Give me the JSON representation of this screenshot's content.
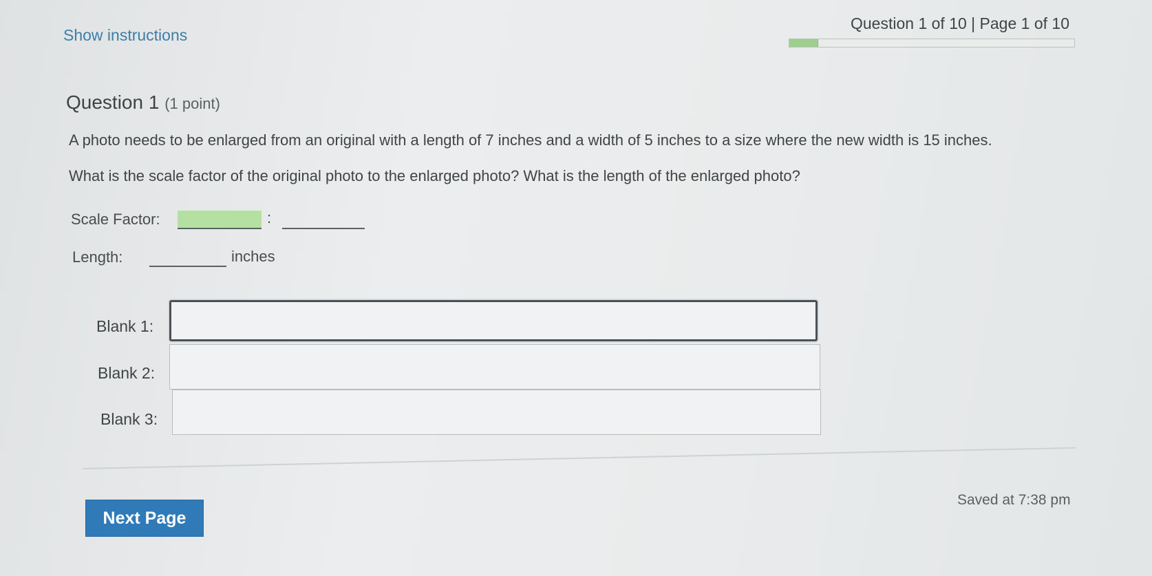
{
  "header": {
    "show_instructions": "Show instructions",
    "progress_label": "Question 1 of 10 | Page 1 of 10",
    "progress_fraction": 0.1
  },
  "question": {
    "title": "Question 1",
    "points": "(1 point)",
    "text_line_1": "A photo needs to be enlarged from an original with a length of 7 inches and a width of 5 inches to a size where the new width is 15 inches.",
    "text_line_2": "What is the scale factor of the original photo to the enlarged photo? What is the length of the enlarged photo?",
    "scale_factor_label": "Scale Factor:",
    "colon": ":",
    "length_label": "Length:",
    "inches_label": "inches"
  },
  "blanks": [
    {
      "label": "Blank 1:",
      "value": ""
    },
    {
      "label": "Blank 2:",
      "value": ""
    },
    {
      "label": "Blank 3:",
      "value": ""
    }
  ],
  "footer": {
    "next_button": "Next Page",
    "saved_status": "Saved at 7:38 pm"
  },
  "colors": {
    "link": "#3d7ea9",
    "progress_fill": "#9fcf8e",
    "highlight_blank": "#b4e0a2",
    "button": "#2f7ab7"
  }
}
